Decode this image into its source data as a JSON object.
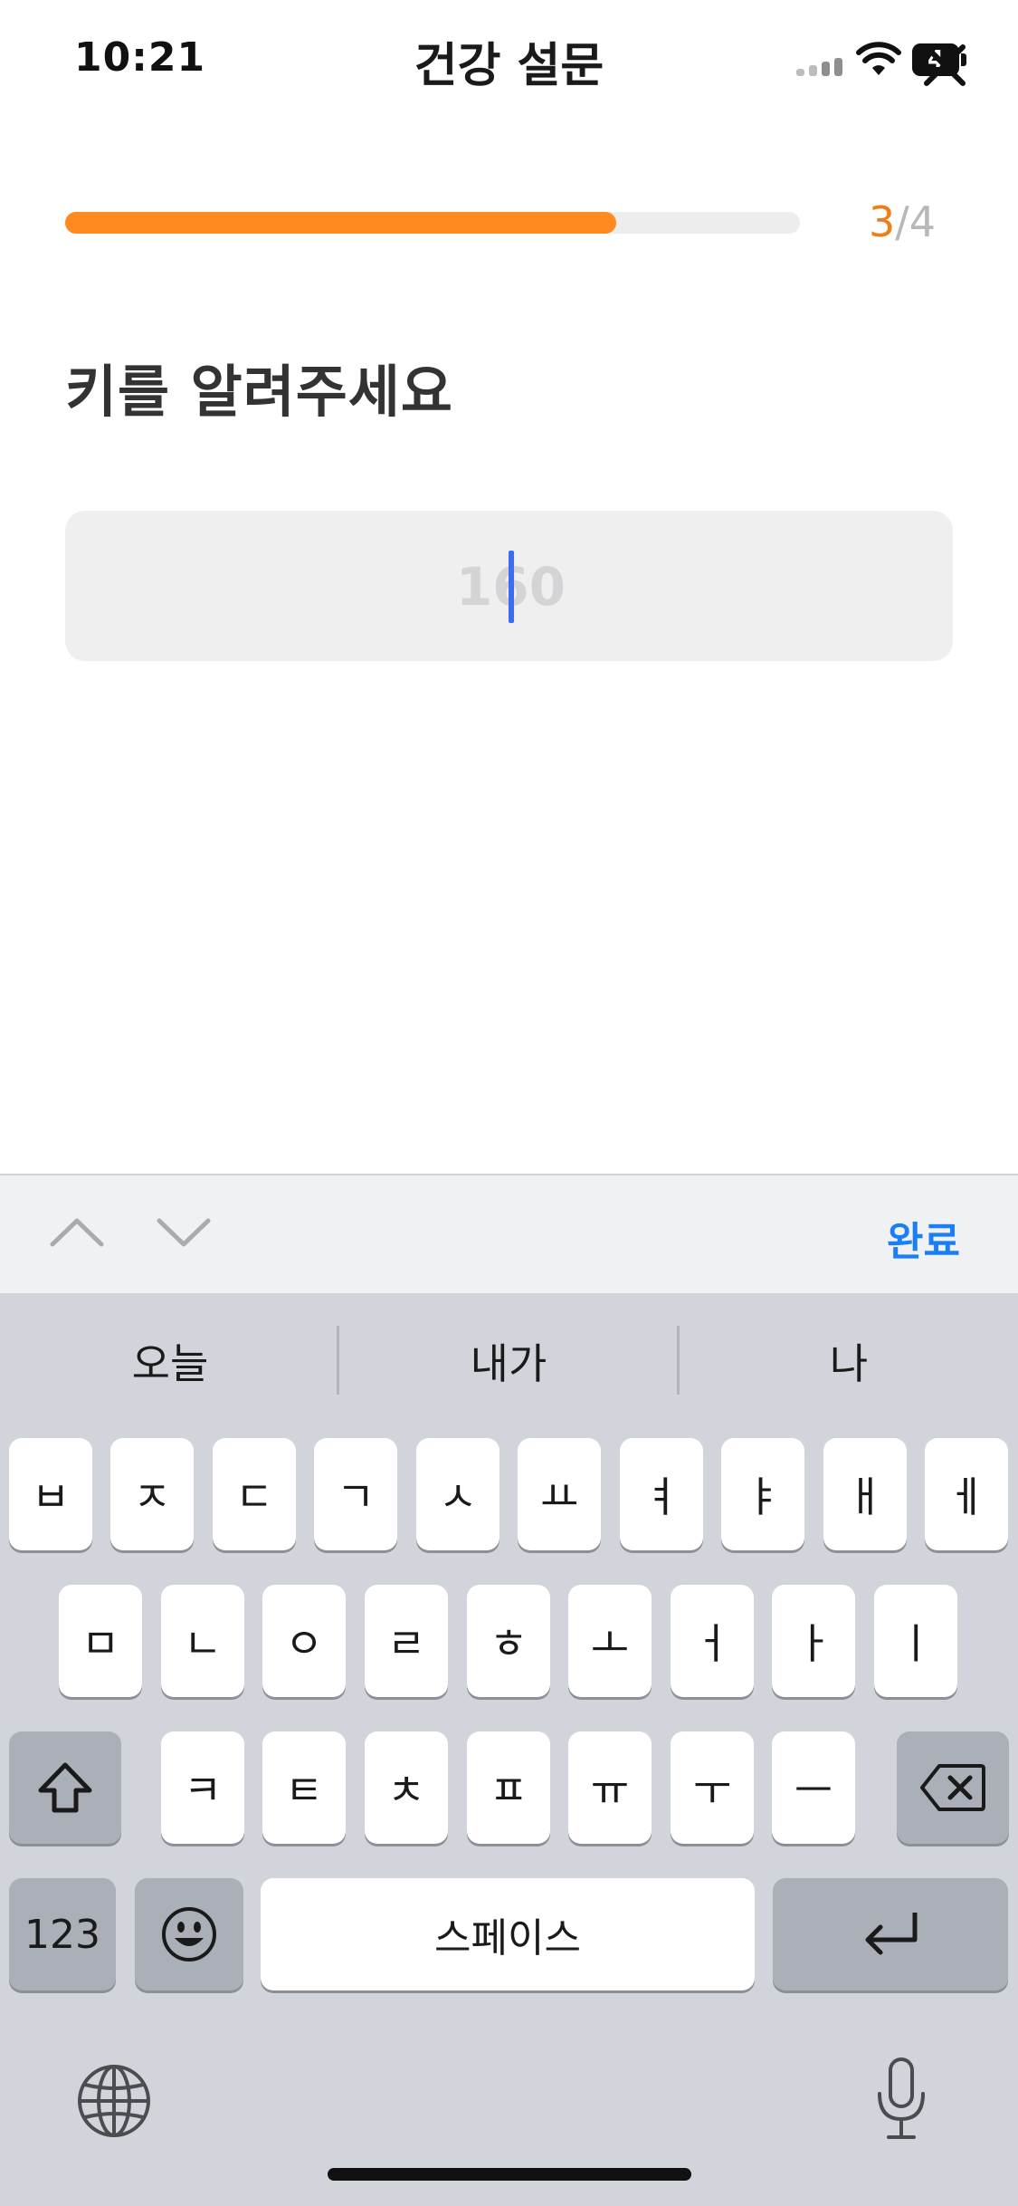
{
  "status_bar": {
    "time": "10:21",
    "battery_level": "4"
  },
  "header": {
    "title": "건강 설문"
  },
  "progress": {
    "current": "3",
    "separator": "/",
    "total": "4",
    "fraction": 0.75
  },
  "question": {
    "text": "키를 알려주세요"
  },
  "height_input": {
    "placeholder": "160",
    "value": ""
  },
  "accessory": {
    "done_label": "완료"
  },
  "keyboard": {
    "suggestions": [
      "오늘",
      "내가",
      "나"
    ],
    "row1": [
      "ㅂ",
      "ㅈ",
      "ㄷ",
      "ㄱ",
      "ㅅ",
      "ㅛ",
      "ㅕ",
      "ㅑ",
      "ㅐ",
      "ㅔ"
    ],
    "row2": [
      "ㅁ",
      "ㄴ",
      "ㅇ",
      "ㄹ",
      "ㅎ",
      "ㅗ",
      "ㅓ",
      "ㅏ",
      "ㅣ"
    ],
    "row3": [
      "ㅋ",
      "ㅌ",
      "ㅊ",
      "ㅍ",
      "ㅠ",
      "ㅜ",
      "ㅡ"
    ],
    "numbers_label": "123",
    "space_label": "스페이스"
  },
  "colors": {
    "accent": "#ff8a1f",
    "link": "#1a7ef5",
    "caret": "#3d6cf0"
  }
}
